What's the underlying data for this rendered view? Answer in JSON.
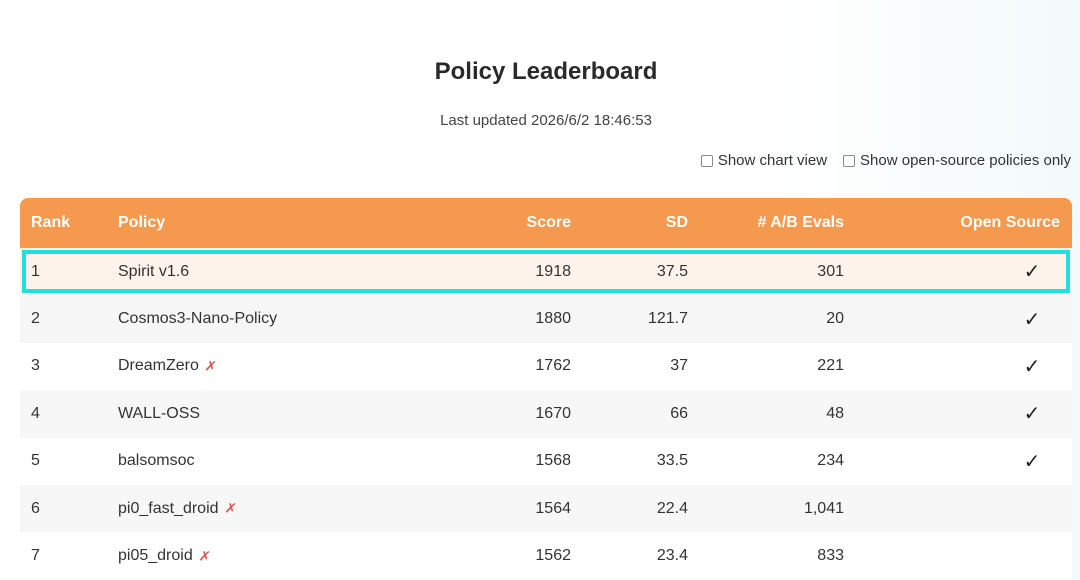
{
  "page": {
    "title": "Policy Leaderboard",
    "last_updated": "Last updated 2026/6/2 18:46:53"
  },
  "toggles": {
    "chart_view": "Show chart view",
    "open_source_only": "Show open-source policies only"
  },
  "table": {
    "headers": {
      "rank": "Rank",
      "policy": "Policy",
      "score": "Score",
      "sd": "SD",
      "evals": "# A/B Evals",
      "open_source": "Open Source"
    },
    "rows": [
      {
        "rank": "1",
        "policy": "Spirit v1.6",
        "score": "1918",
        "sd": "37.5",
        "evals": "301",
        "open_source": "✓",
        "tag": ""
      },
      {
        "rank": "2",
        "policy": "Cosmos3-Nano-Policy",
        "score": "1880",
        "sd": "121.7",
        "evals": "20",
        "open_source": "✓",
        "tag": ""
      },
      {
        "rank": "3",
        "policy": "DreamZero",
        "score": "1762",
        "sd": "37",
        "evals": "221",
        "open_source": "✓",
        "tag": "✗"
      },
      {
        "rank": "4",
        "policy": "WALL-OSS",
        "score": "1670",
        "sd": "66",
        "evals": "48",
        "open_source": "✓",
        "tag": ""
      },
      {
        "rank": "5",
        "policy": "balsomsoc",
        "score": "1568",
        "sd": "33.5",
        "evals": "234",
        "open_source": "✓",
        "tag": ""
      },
      {
        "rank": "6",
        "policy": "pi0_fast_droid",
        "score": "1564",
        "sd": "22.4",
        "evals": "1,041",
        "open_source": "",
        "tag": "✗"
      },
      {
        "rank": "7",
        "policy": "pi05_droid",
        "score": "1562",
        "sd": "23.4",
        "evals": "833",
        "open_source": "",
        "tag": "✗"
      }
    ]
  },
  "colors": {
    "header_bg": "#f4994d",
    "highlight_outline": "#1fe0df",
    "tag_icon": "#d9534f"
  },
  "icons": {
    "check": "check-icon",
    "tag": "x-mark-icon"
  }
}
